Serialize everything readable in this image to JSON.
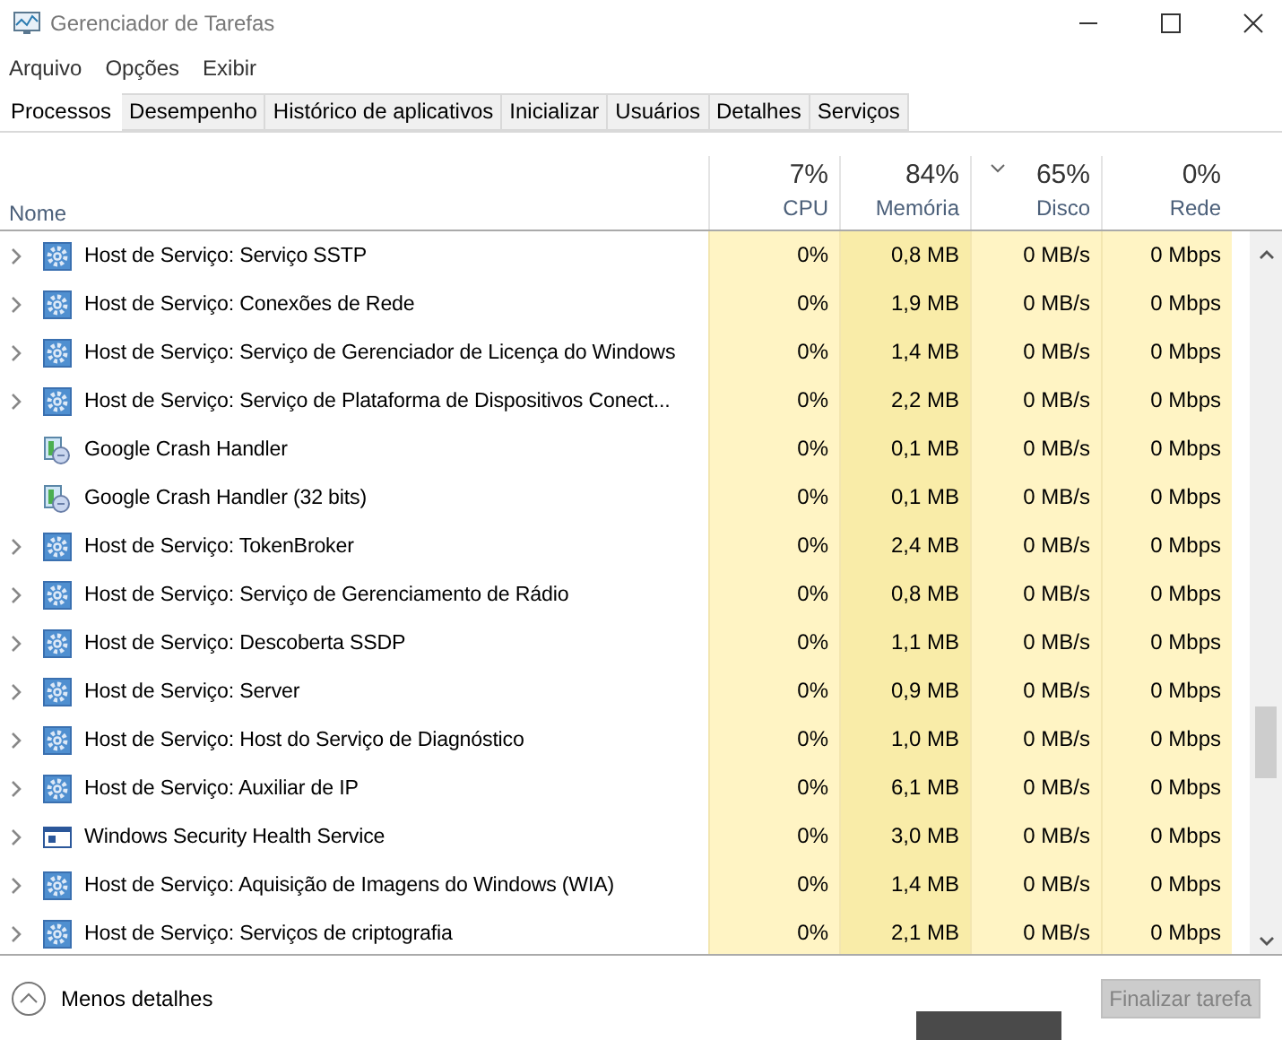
{
  "window": {
    "title": "Gerenciador de Tarefas"
  },
  "menu": [
    "Arquivo",
    "Opções",
    "Exibir"
  ],
  "tabs": [
    {
      "label": "Processos",
      "selected": true
    },
    {
      "label": "Desempenho",
      "selected": false
    },
    {
      "label": "Histórico de aplicativos",
      "selected": false
    },
    {
      "label": "Inicializar",
      "selected": false
    },
    {
      "label": "Usuários",
      "selected": false
    },
    {
      "label": "Detalhes",
      "selected": false
    },
    {
      "label": "Serviços",
      "selected": false
    }
  ],
  "table": {
    "name_column": "Nome",
    "columns": [
      {
        "total": "7%",
        "label": "CPU",
        "color": "#fff4c4",
        "sorted": false
      },
      {
        "total": "84%",
        "label": "Memória",
        "color": "#f9eca8",
        "sorted": false
      },
      {
        "total": "65%",
        "label": "Disco",
        "color": "#fff4c4",
        "sorted": true
      },
      {
        "total": "0%",
        "label": "Rede",
        "color": "#fff4c4",
        "sorted": false
      }
    ],
    "rows": [
      {
        "kind": "service",
        "expandable": true,
        "name": "Host de Serviço: Serviço SSTP",
        "values": [
          "0%",
          "0,8 MB",
          "0 MB/s",
          "0 Mbps"
        ]
      },
      {
        "kind": "service",
        "expandable": true,
        "name": "Host de Serviço: Conexões de Rede",
        "values": [
          "0%",
          "1,9 MB",
          "0 MB/s",
          "0 Mbps"
        ]
      },
      {
        "kind": "service",
        "expandable": true,
        "name": "Host de Serviço: Serviço de Gerenciador de Licença do Windows",
        "values": [
          "0%",
          "1,4 MB",
          "0 MB/s",
          "0 Mbps"
        ]
      },
      {
        "kind": "service",
        "expandable": true,
        "name": "Host de Serviço: Serviço de Plataforma de Dispositivos Conect...",
        "values": [
          "0%",
          "2,2 MB",
          "0 MB/s",
          "0 Mbps"
        ]
      },
      {
        "kind": "app",
        "expandable": false,
        "name": "Google Crash Handler",
        "values": [
          "0%",
          "0,1 MB",
          "0 MB/s",
          "0 Mbps"
        ]
      },
      {
        "kind": "app",
        "expandable": false,
        "name": "Google Crash Handler (32 bits)",
        "values": [
          "0%",
          "0,1 MB",
          "0 MB/s",
          "0 Mbps"
        ]
      },
      {
        "kind": "service",
        "expandable": true,
        "name": "Host de Serviço: TokenBroker",
        "values": [
          "0%",
          "2,4 MB",
          "0 MB/s",
          "0 Mbps"
        ]
      },
      {
        "kind": "service",
        "expandable": true,
        "name": "Host de Serviço: Serviço de Gerenciamento de Rádio",
        "values": [
          "0%",
          "0,8 MB",
          "0 MB/s",
          "0 Mbps"
        ]
      },
      {
        "kind": "service",
        "expandable": true,
        "name": "Host de Serviço: Descoberta SSDP",
        "values": [
          "0%",
          "1,1 MB",
          "0 MB/s",
          "0 Mbps"
        ]
      },
      {
        "kind": "service",
        "expandable": true,
        "name": "Host de Serviço: Server",
        "values": [
          "0%",
          "0,9 MB",
          "0 MB/s",
          "0 Mbps"
        ]
      },
      {
        "kind": "service",
        "expandable": true,
        "name": "Host de Serviço: Host do Serviço de Diagnóstico",
        "values": [
          "0%",
          "1,0 MB",
          "0 MB/s",
          "0 Mbps"
        ]
      },
      {
        "kind": "service",
        "expandable": true,
        "name": "Host de Serviço: Auxiliar de IP",
        "values": [
          "0%",
          "6,1 MB",
          "0 MB/s",
          "0 Mbps"
        ]
      },
      {
        "kind": "window",
        "expandable": true,
        "name": "Windows Security Health Service",
        "values": [
          "0%",
          "3,0 MB",
          "0 MB/s",
          "0 Mbps"
        ]
      },
      {
        "kind": "service",
        "expandable": true,
        "name": "Host de Serviço: Aquisição de Imagens do Windows (WIA)",
        "values": [
          "0%",
          "1,4 MB",
          "0 MB/s",
          "0 Mbps"
        ]
      },
      {
        "kind": "service",
        "expandable": true,
        "name": "Host de Serviço: Serviços de criptografia",
        "values": [
          "0%",
          "2,1 MB",
          "0 MB/s",
          "0 Mbps"
        ]
      }
    ]
  },
  "footer": {
    "details_label": "Menos detalhes",
    "end_task": {
      "label": "Finalizar tarefa",
      "disabled": true
    }
  }
}
